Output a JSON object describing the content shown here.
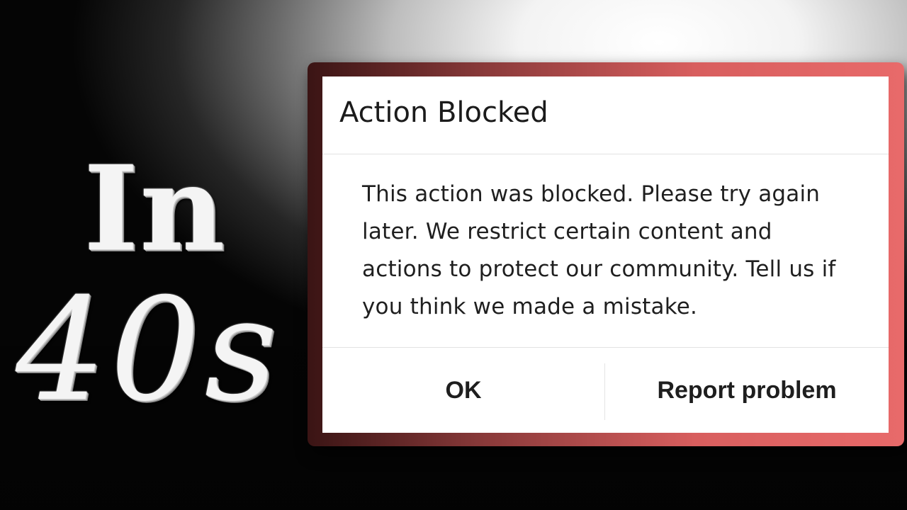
{
  "overlay": {
    "line1": "In",
    "line2": "40s"
  },
  "dialog": {
    "title": "Action Blocked",
    "body": "This action was blocked. Please try again later. We restrict certain content and actions to protect our community. Tell us if you think we made a mistake.",
    "buttons": {
      "ok": "OK",
      "report": "Report problem"
    }
  },
  "colors": {
    "frame_accent": "#e86a6a",
    "dialog_background": "#ffffff",
    "text": "#1b1b1b"
  }
}
